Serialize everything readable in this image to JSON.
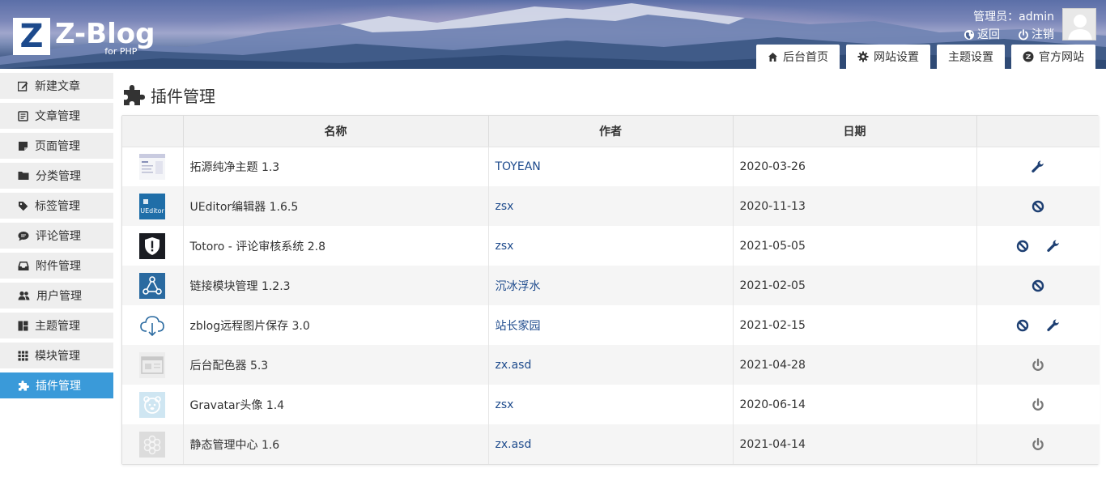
{
  "header": {
    "logo_mark": "Z",
    "logo_text": "Z-Blog",
    "logo_sub": "for PHP",
    "admin_label": "管理员：admin",
    "back_label": "返回",
    "logout_label": "注销",
    "tabs": [
      {
        "label": "后台首页",
        "icon": "home-icon"
      },
      {
        "label": "网站设置",
        "icon": "gear-icon"
      },
      {
        "label": "主题设置",
        "icon": ""
      },
      {
        "label": "官方网站",
        "icon": "zblog-icon"
      }
    ]
  },
  "sidebar": {
    "items": [
      {
        "label": "新建文章",
        "icon": "edit-icon"
      },
      {
        "label": "文章管理",
        "icon": "article-icon"
      },
      {
        "label": "页面管理",
        "icon": "page-icon"
      },
      {
        "label": "分类管理",
        "icon": "folder-icon"
      },
      {
        "label": "标签管理",
        "icon": "tag-icon"
      },
      {
        "label": "评论管理",
        "icon": "comment-icon"
      },
      {
        "label": "附件管理",
        "icon": "inbox-icon"
      },
      {
        "label": "用户管理",
        "icon": "users-icon"
      },
      {
        "label": "主题管理",
        "icon": "layout-icon"
      },
      {
        "label": "模块管理",
        "icon": "grid-icon"
      },
      {
        "label": "插件管理",
        "icon": "puzzle-icon",
        "active": true
      }
    ]
  },
  "main": {
    "title": "插件管理",
    "columns": [
      "",
      "名称",
      "作者",
      "日期",
      ""
    ],
    "rows": [
      {
        "name": "拓源纯净主题 1.3",
        "author": "TOYEAN",
        "date": "2020-03-26",
        "ops": [
          "settings"
        ]
      },
      {
        "name": "UEditor编辑器 1.6.5",
        "author": "zsx",
        "date": "2020-11-13",
        "ops": [
          "disable"
        ]
      },
      {
        "name": "Totoro - 评论审核系统 2.8",
        "author": "zsx",
        "date": "2021-05-05",
        "ops": [
          "disable",
          "settings"
        ]
      },
      {
        "name": "链接模块管理 1.2.3",
        "author": "沉冰浮水",
        "date": "2021-02-05",
        "ops": [
          "disable"
        ]
      },
      {
        "name": "zblog远程图片保存 3.0",
        "author": "站长家园",
        "date": "2021-02-15",
        "ops": [
          "disable",
          "settings"
        ]
      },
      {
        "name": "后台配色器 5.3",
        "author": "zx.asd",
        "date": "2021-04-28",
        "ops": [
          "enable"
        ]
      },
      {
        "name": "Gravatar头像 1.4",
        "author": "zsx",
        "date": "2020-06-14",
        "ops": [
          "enable"
        ]
      },
      {
        "name": "静态管理中心 1.6",
        "author": "zx.asd",
        "date": "2021-04-14",
        "ops": [
          "enable"
        ]
      }
    ]
  },
  "colors": {
    "accent": "#3a9ad9",
    "link": "#1d4a8c",
    "icon_dark": "#1d3f72",
    "icon_grey": "#777777"
  }
}
